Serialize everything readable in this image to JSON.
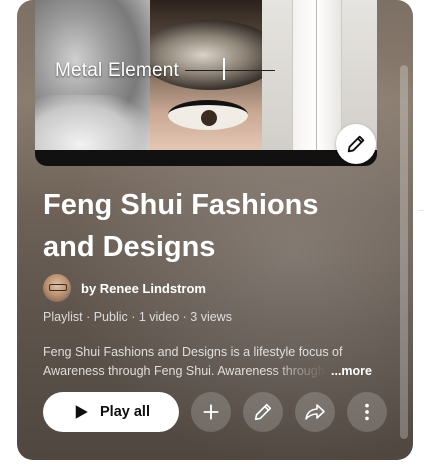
{
  "thumbnail": {
    "caption": "Metal Element",
    "edit_icon": "pencil-icon"
  },
  "playlist": {
    "title_line1": "Feng Shui Fashions",
    "title_line2": "and Designs",
    "owner": "by Renee Lindstrom",
    "meta": "Playlist · Public · 1 video · 3 views",
    "description_line1": "Feng Shui Fashions and Designs is a  lifestyle focus of",
    "description_line2": "Awareness through Feng Shui. Awareness through",
    "more_label": "...more"
  },
  "actions": {
    "play_all_label": "Play all",
    "play_icon": "play-icon",
    "add_icon": "plus-icon",
    "edit_icon": "pencil-icon",
    "share_icon": "share-arrow-icon",
    "more_icon": "vertical-dots-icon"
  },
  "colors": {
    "card_background": "#7d7064",
    "text": "#ffffff",
    "button_background": "#ffffff"
  }
}
